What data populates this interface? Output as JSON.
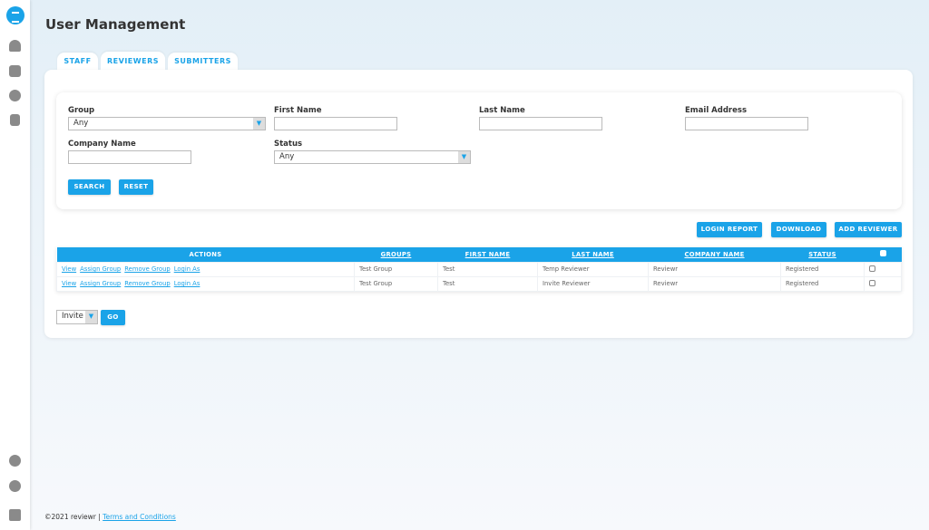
{
  "header": {
    "title": "User Management"
  },
  "tabs": [
    {
      "label": "STAFF"
    },
    {
      "label": "REVIEWERS",
      "active": true
    },
    {
      "label": "SUBMITTERS"
    }
  ],
  "filters": {
    "group_label": "Group",
    "group_value": "Any",
    "first_name_label": "First Name",
    "first_name_value": "",
    "last_name_label": "Last Name",
    "last_name_value": "",
    "email_label": "Email Address",
    "email_value": "",
    "company_label": "Company Name",
    "company_value": "",
    "status_label": "Status",
    "status_value": "Any",
    "search": "SEARCH",
    "reset": "RESET"
  },
  "toolbar": {
    "login_report": "LOGIN REPORT",
    "download": "DOWNLOAD",
    "add_reviewer": "ADD REVIEWER"
  },
  "table": {
    "headers": [
      "ACTIONS",
      "GROUPS",
      "FIRST NAME",
      "LAST NAME",
      "COMPANY NAME",
      "STATUS"
    ],
    "actions": [
      "View",
      "Assign Group",
      "Remove Group",
      "Login As"
    ],
    "rows": [
      {
        "group": "Test Group",
        "first": "Test",
        "last": "Temp Reviewer",
        "company": "Reviewr",
        "status": "Registered",
        "checked": false
      },
      {
        "group": "Test Group",
        "first": "Test",
        "last": "Invite Reviewer",
        "company": "Reviewr",
        "status": "Registered",
        "checked": false
      }
    ]
  },
  "bulk": {
    "action": "Invite",
    "go": "GO"
  },
  "footer": {
    "copyright": "©2021 reviewr |",
    "terms": "Terms and Conditions"
  },
  "colors": {
    "accent": "#1aa3e8"
  }
}
